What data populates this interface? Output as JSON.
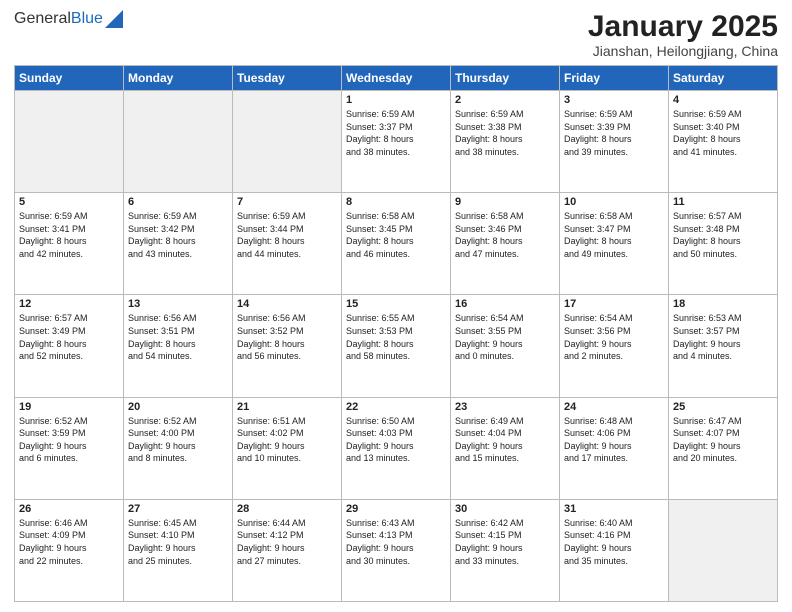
{
  "logo": {
    "general": "General",
    "blue": "Blue"
  },
  "title": "January 2025",
  "subtitle": "Jianshan, Heilongjiang, China",
  "days_of_week": [
    "Sunday",
    "Monday",
    "Tuesday",
    "Wednesday",
    "Thursday",
    "Friday",
    "Saturday"
  ],
  "weeks": [
    [
      {
        "day": "",
        "info": ""
      },
      {
        "day": "",
        "info": ""
      },
      {
        "day": "",
        "info": ""
      },
      {
        "day": "1",
        "info": "Sunrise: 6:59 AM\nSunset: 3:37 PM\nDaylight: 8 hours\nand 38 minutes."
      },
      {
        "day": "2",
        "info": "Sunrise: 6:59 AM\nSunset: 3:38 PM\nDaylight: 8 hours\nand 38 minutes."
      },
      {
        "day": "3",
        "info": "Sunrise: 6:59 AM\nSunset: 3:39 PM\nDaylight: 8 hours\nand 39 minutes."
      },
      {
        "day": "4",
        "info": "Sunrise: 6:59 AM\nSunset: 3:40 PM\nDaylight: 8 hours\nand 41 minutes."
      }
    ],
    [
      {
        "day": "5",
        "info": "Sunrise: 6:59 AM\nSunset: 3:41 PM\nDaylight: 8 hours\nand 42 minutes."
      },
      {
        "day": "6",
        "info": "Sunrise: 6:59 AM\nSunset: 3:42 PM\nDaylight: 8 hours\nand 43 minutes."
      },
      {
        "day": "7",
        "info": "Sunrise: 6:59 AM\nSunset: 3:44 PM\nDaylight: 8 hours\nand 44 minutes."
      },
      {
        "day": "8",
        "info": "Sunrise: 6:58 AM\nSunset: 3:45 PM\nDaylight: 8 hours\nand 46 minutes."
      },
      {
        "day": "9",
        "info": "Sunrise: 6:58 AM\nSunset: 3:46 PM\nDaylight: 8 hours\nand 47 minutes."
      },
      {
        "day": "10",
        "info": "Sunrise: 6:58 AM\nSunset: 3:47 PM\nDaylight: 8 hours\nand 49 minutes."
      },
      {
        "day": "11",
        "info": "Sunrise: 6:57 AM\nSunset: 3:48 PM\nDaylight: 8 hours\nand 50 minutes."
      }
    ],
    [
      {
        "day": "12",
        "info": "Sunrise: 6:57 AM\nSunset: 3:49 PM\nDaylight: 8 hours\nand 52 minutes."
      },
      {
        "day": "13",
        "info": "Sunrise: 6:56 AM\nSunset: 3:51 PM\nDaylight: 8 hours\nand 54 minutes."
      },
      {
        "day": "14",
        "info": "Sunrise: 6:56 AM\nSunset: 3:52 PM\nDaylight: 8 hours\nand 56 minutes."
      },
      {
        "day": "15",
        "info": "Sunrise: 6:55 AM\nSunset: 3:53 PM\nDaylight: 8 hours\nand 58 minutes."
      },
      {
        "day": "16",
        "info": "Sunrise: 6:54 AM\nSunset: 3:55 PM\nDaylight: 9 hours\nand 0 minutes."
      },
      {
        "day": "17",
        "info": "Sunrise: 6:54 AM\nSunset: 3:56 PM\nDaylight: 9 hours\nand 2 minutes."
      },
      {
        "day": "18",
        "info": "Sunrise: 6:53 AM\nSunset: 3:57 PM\nDaylight: 9 hours\nand 4 minutes."
      }
    ],
    [
      {
        "day": "19",
        "info": "Sunrise: 6:52 AM\nSunset: 3:59 PM\nDaylight: 9 hours\nand 6 minutes."
      },
      {
        "day": "20",
        "info": "Sunrise: 6:52 AM\nSunset: 4:00 PM\nDaylight: 9 hours\nand 8 minutes."
      },
      {
        "day": "21",
        "info": "Sunrise: 6:51 AM\nSunset: 4:02 PM\nDaylight: 9 hours\nand 10 minutes."
      },
      {
        "day": "22",
        "info": "Sunrise: 6:50 AM\nSunset: 4:03 PM\nDaylight: 9 hours\nand 13 minutes."
      },
      {
        "day": "23",
        "info": "Sunrise: 6:49 AM\nSunset: 4:04 PM\nDaylight: 9 hours\nand 15 minutes."
      },
      {
        "day": "24",
        "info": "Sunrise: 6:48 AM\nSunset: 4:06 PM\nDaylight: 9 hours\nand 17 minutes."
      },
      {
        "day": "25",
        "info": "Sunrise: 6:47 AM\nSunset: 4:07 PM\nDaylight: 9 hours\nand 20 minutes."
      }
    ],
    [
      {
        "day": "26",
        "info": "Sunrise: 6:46 AM\nSunset: 4:09 PM\nDaylight: 9 hours\nand 22 minutes."
      },
      {
        "day": "27",
        "info": "Sunrise: 6:45 AM\nSunset: 4:10 PM\nDaylight: 9 hours\nand 25 minutes."
      },
      {
        "day": "28",
        "info": "Sunrise: 6:44 AM\nSunset: 4:12 PM\nDaylight: 9 hours\nand 27 minutes."
      },
      {
        "day": "29",
        "info": "Sunrise: 6:43 AM\nSunset: 4:13 PM\nDaylight: 9 hours\nand 30 minutes."
      },
      {
        "day": "30",
        "info": "Sunrise: 6:42 AM\nSunset: 4:15 PM\nDaylight: 9 hours\nand 33 minutes."
      },
      {
        "day": "31",
        "info": "Sunrise: 6:40 AM\nSunset: 4:16 PM\nDaylight: 9 hours\nand 35 minutes."
      },
      {
        "day": "",
        "info": ""
      }
    ]
  ]
}
